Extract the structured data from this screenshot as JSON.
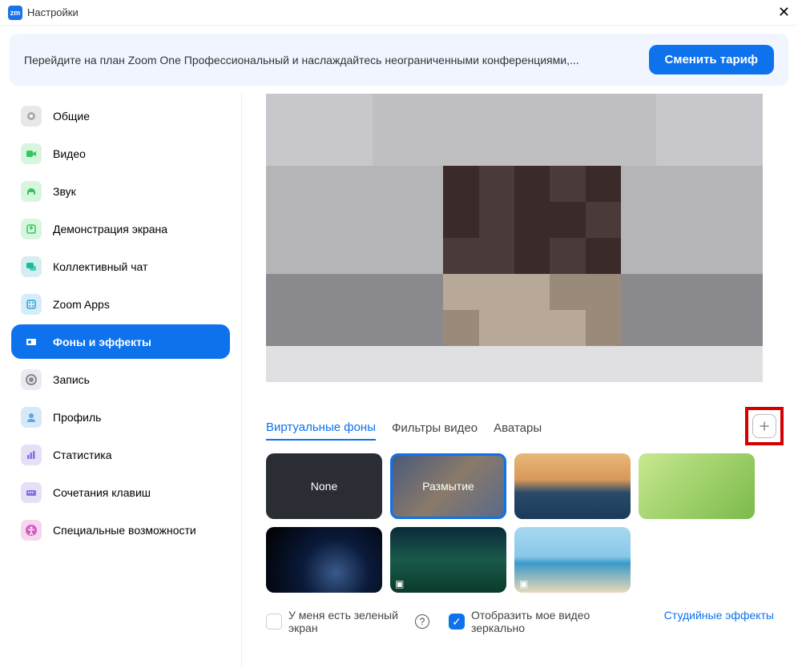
{
  "window": {
    "title": "Настройки",
    "logo_text": "zm"
  },
  "banner": {
    "text": "Перейдите на план Zoom One Профессиональный и наслаждайтесь неограниченными конференциями,...",
    "button": "Сменить тариф"
  },
  "sidebar": {
    "items": [
      {
        "label": "Общие",
        "icon": "gear",
        "color": "#e6e8ea",
        "glyph": "#aaa"
      },
      {
        "label": "Видео",
        "icon": "video",
        "color": "#d8f5e0",
        "glyph": "#34c759"
      },
      {
        "label": "Звук",
        "icon": "headphones",
        "color": "#d8f5e0",
        "glyph": "#34c759"
      },
      {
        "label": "Демонстрация экрана",
        "icon": "share",
        "color": "#d8f5e0",
        "glyph": "#34c759"
      },
      {
        "label": "Коллективный чат",
        "icon": "chat",
        "color": "#d4efef",
        "glyph": "#1abc9c"
      },
      {
        "label": "Zoom Apps",
        "icon": "apps",
        "color": "#d7ecf9",
        "glyph": "#2a9fd6"
      },
      {
        "label": "Фоны и эффекты",
        "icon": "background",
        "color": "#0e72ed",
        "glyph": "#fff",
        "active": true
      },
      {
        "label": "Запись",
        "icon": "record",
        "color": "#eaeaf2",
        "glyph": "#888"
      },
      {
        "label": "Профиль",
        "icon": "profile",
        "color": "#d7e8f7",
        "glyph": "#5fa8e8"
      },
      {
        "label": "Статистика",
        "icon": "stats",
        "color": "#e6e0f7",
        "glyph": "#8a6ee8"
      },
      {
        "label": "Сочетания клавиш",
        "icon": "keyboard",
        "color": "#e6e0f7",
        "glyph": "#8a6ee8"
      },
      {
        "label": "Специальные возможности",
        "icon": "accessibility",
        "color": "#f5d7ef",
        "glyph": "#d65cc0"
      }
    ]
  },
  "tabs": {
    "items": [
      {
        "label": "Виртуальные фоны",
        "active": true
      },
      {
        "label": "Фильтры видео"
      },
      {
        "label": "Аватары"
      }
    ]
  },
  "backgrounds": {
    "items": [
      {
        "label": "None",
        "style": "black"
      },
      {
        "label": "Размытие",
        "style": "blur",
        "selected": true
      },
      {
        "label": "",
        "style": "bridge"
      },
      {
        "label": "",
        "style": "grass"
      },
      {
        "label": "",
        "style": "space"
      },
      {
        "label": "",
        "style": "aurora",
        "video": true
      },
      {
        "label": "",
        "style": "beach",
        "video": true
      }
    ]
  },
  "options": {
    "greenscreen": {
      "label": "У меня есть зеленый экран",
      "checked": false
    },
    "mirror": {
      "label": "Отобразить мое видео зеркально",
      "checked": true
    },
    "studio_link": "Студийные эффекты"
  }
}
